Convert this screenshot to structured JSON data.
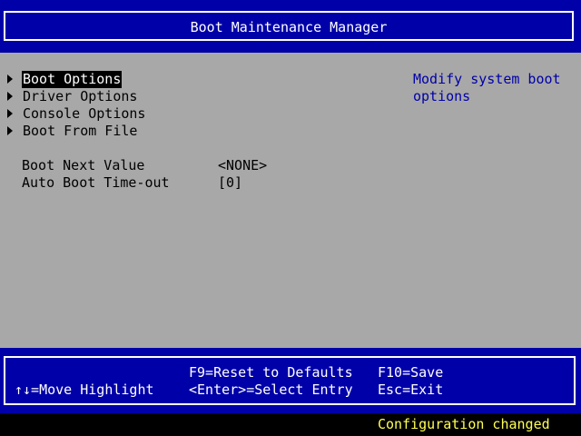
{
  "header": {
    "title": "Boot Maintenance Manager"
  },
  "menu": {
    "items": [
      {
        "label": "Boot Options",
        "selected": true
      },
      {
        "label": "Driver Options",
        "selected": false
      },
      {
        "label": "Console Options",
        "selected": false
      },
      {
        "label": "Boot From File",
        "selected": false
      }
    ]
  },
  "fields": {
    "boot_next": {
      "label": "Boot Next Value",
      "value": "<NONE>"
    },
    "auto_boot": {
      "label": "Auto Boot Time-out",
      "value": "[0]"
    }
  },
  "help": {
    "text": "Modify system boot\noptions"
  },
  "footer": {
    "move_highlight": "↑↓=Move Highlight",
    "reset_defaults": "F9=Reset to Defaults",
    "select_entry": "<Enter>=Select Entry",
    "save": "F10=Save",
    "exit": "Esc=Exit"
  },
  "status": {
    "text": "Configuration changed"
  },
  "colors": {
    "header_bg": "#0000a8",
    "body_bg": "#a8a8a8",
    "help_text": "#0000a8",
    "status_text": "#ffff54"
  }
}
